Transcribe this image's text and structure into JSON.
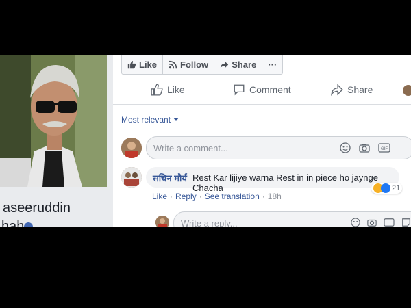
{
  "profile": {
    "name_line1": "aseeruddin",
    "name_line2": "hah"
  },
  "post_actions": {
    "like": "Like",
    "follow": "Follow",
    "share": "Share",
    "more": "···"
  },
  "reactions": {
    "like": "Like",
    "comment": "Comment",
    "share": "Share"
  },
  "sort": {
    "label": "Most relevant"
  },
  "comment_box": {
    "placeholder": "Write a comment..."
  },
  "comment": {
    "author": "सचिन मौर्य",
    "text": "Rest Kar lijiye warna Rest in in piece ho jaynge Chacha",
    "reaction_count": "21",
    "actions": {
      "like": "Like",
      "reply": "Reply",
      "see_translation": "See translation",
      "time": "18h"
    }
  },
  "reply_box": {
    "placeholder": "Write a reply..."
  },
  "colors": {
    "link_blue": "#385898",
    "muted_gray": "#90949c",
    "verified_blue": "#4267b2"
  }
}
